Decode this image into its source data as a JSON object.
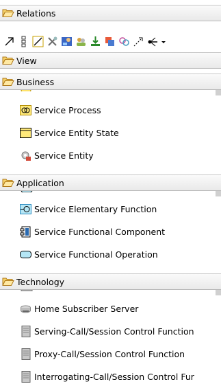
{
  "relations": {
    "title": "Relations"
  },
  "view": {
    "title": "View"
  },
  "business": {
    "title": "Business",
    "items": [
      {
        "label": "Service Process",
        "icon": "service-process-icon"
      },
      {
        "label": "Service Entity State",
        "icon": "entity-state-icon"
      },
      {
        "label": "Service Entity",
        "icon": "service-entity-icon"
      }
    ]
  },
  "application": {
    "title": "Application",
    "items": [
      {
        "label": "Service Elementary Function",
        "icon": "elementary-function-icon"
      },
      {
        "label": "Service Functional Component",
        "icon": "functional-component-icon"
      },
      {
        "label": "Service Functional Operation",
        "icon": "functional-operation-icon"
      }
    ]
  },
  "technology": {
    "title": "Technology",
    "items": [
      {
        "label": "Home Subscriber Server",
        "icon": "server-disk-icon"
      },
      {
        "label": "Serving-Call/Session Control Function",
        "icon": "server-tower-icon"
      },
      {
        "label": "Proxy-Call/Session Control Function",
        "icon": "server-tower-icon"
      },
      {
        "label": "Interrogating-Call/Session Control Fur",
        "icon": "server-tower-icon"
      }
    ]
  },
  "colors": {
    "header_gradient_top": "#fafafa",
    "header_gradient_bottom": "#e9e9e9",
    "folder_fill": "#f6d36a",
    "folder_stroke": "#b07a1a"
  }
}
